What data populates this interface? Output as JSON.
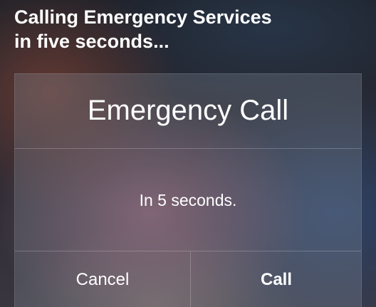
{
  "siri": {
    "line1": "Calling Emergency Services",
    "line2": "in five seconds..."
  },
  "alert": {
    "title": "Emergency Call",
    "message": "In 5 seconds.",
    "buttons": {
      "cancel": "Cancel",
      "call": "Call"
    }
  }
}
